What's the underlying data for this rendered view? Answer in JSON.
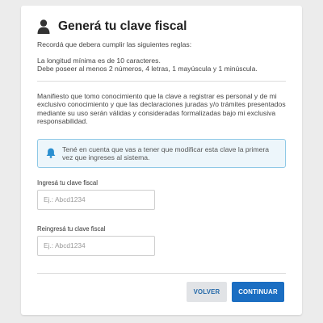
{
  "header": {
    "title": "Generá tu clave fiscal",
    "icon": "user-icon"
  },
  "intro": "Recordá que debera cumplir las siguientes reglas:",
  "rules": [
    "La longitud mínima es de 10 caracteres.",
    "Debe poseer al menos 2 números, 4 letras, 1 mayúscula y 1 minúscula."
  ],
  "declaration": "Manifiesto que tomo conocimiento que la clave a registrar es personal y de mi exclusivo conocimiento y que las declaraciones juradas y/o trámites presentados mediante su uso serán válidas y consideradas formalizadas bajo mi exclusiva responsabilidad.",
  "alert": {
    "icon": "bell-icon",
    "text": "Tené en cuenta que vas a tener que modificar esta clave la primera vez que ingreses al sistema.",
    "color": "#8ec8e6"
  },
  "fields": {
    "password": {
      "label": "Ingresá tu clave fiscal",
      "placeholder": "Ej.: Abcd1234",
      "value": ""
    },
    "confirm": {
      "label": "Reingresá tu clave fiscal",
      "placeholder": "Ej.: Abcd1234",
      "value": ""
    }
  },
  "buttons": {
    "back": "VOLVER",
    "continue": "CONTINUAR"
  },
  "colors": {
    "primary": "#1b6ec2",
    "secondary_bg": "#e1e3e6"
  }
}
